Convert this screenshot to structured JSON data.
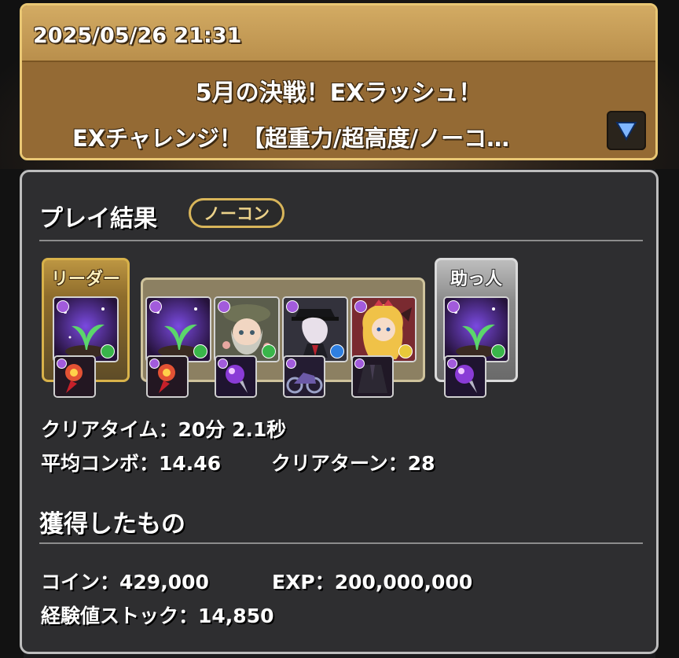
{
  "header": {
    "datetime": "2025/05/26 21:31",
    "title_line1": "5月の決戦！EXラッシュ！",
    "title_line2": "EXチャレンジ！【超重力/超高度/ノーコ…"
  },
  "result": {
    "title": "プレイ結果",
    "badge": "ノーコン",
    "leader_label": "リーダー",
    "helper_label": "助っ人",
    "clear_time_label": "クリアタイム：",
    "clear_time_value": "20分 2.1秒",
    "avg_combo_label": "平均コンボ：",
    "avg_combo_value": "14.46",
    "clear_turn_label": "クリアターン：",
    "clear_turn_value": "28"
  },
  "rewards": {
    "title": "獲得したもの",
    "coin_label": "コイン：",
    "coin_value": "429,000",
    "exp_label": "EXP：",
    "exp_value": "200,000,000",
    "stock_label": "経験値ストック：",
    "stock_value": "14,850"
  },
  "team": [
    {
      "role": "leader",
      "icon": "sprout-monster-icon",
      "sub_attr": "wood",
      "assist": "red-crystal-assist-icon"
    },
    {
      "role": "sub1",
      "icon": "sprout-monster-icon",
      "sub_attr": "wood",
      "assist": "red-crystal-assist-icon"
    },
    {
      "role": "sub2",
      "icon": "girl-with-hat-monster-icon",
      "sub_attr": "wood",
      "assist": "purple-orb-assist-icon"
    },
    {
      "role": "sub3",
      "icon": "masked-gentleman-monster-icon",
      "sub_attr": "water",
      "assist": "motorcycle-assist-icon"
    },
    {
      "role": "sub4",
      "icon": "blonde-princess-monster-icon",
      "sub_attr": "light",
      "assist": "dark-coat-assist-icon"
    },
    {
      "role": "helper",
      "icon": "sprout-monster-icon",
      "sub_attr": "wood",
      "assist": "purple-orb-assist-icon"
    }
  ],
  "colors": {
    "header_gold": "#e9c774",
    "panel_bg": "#2e2e30",
    "dark_attr": "#a25bdc",
    "wood_attr": "#39b54a",
    "water_attr": "#2f7fe0",
    "light_attr": "#e8c93a"
  }
}
